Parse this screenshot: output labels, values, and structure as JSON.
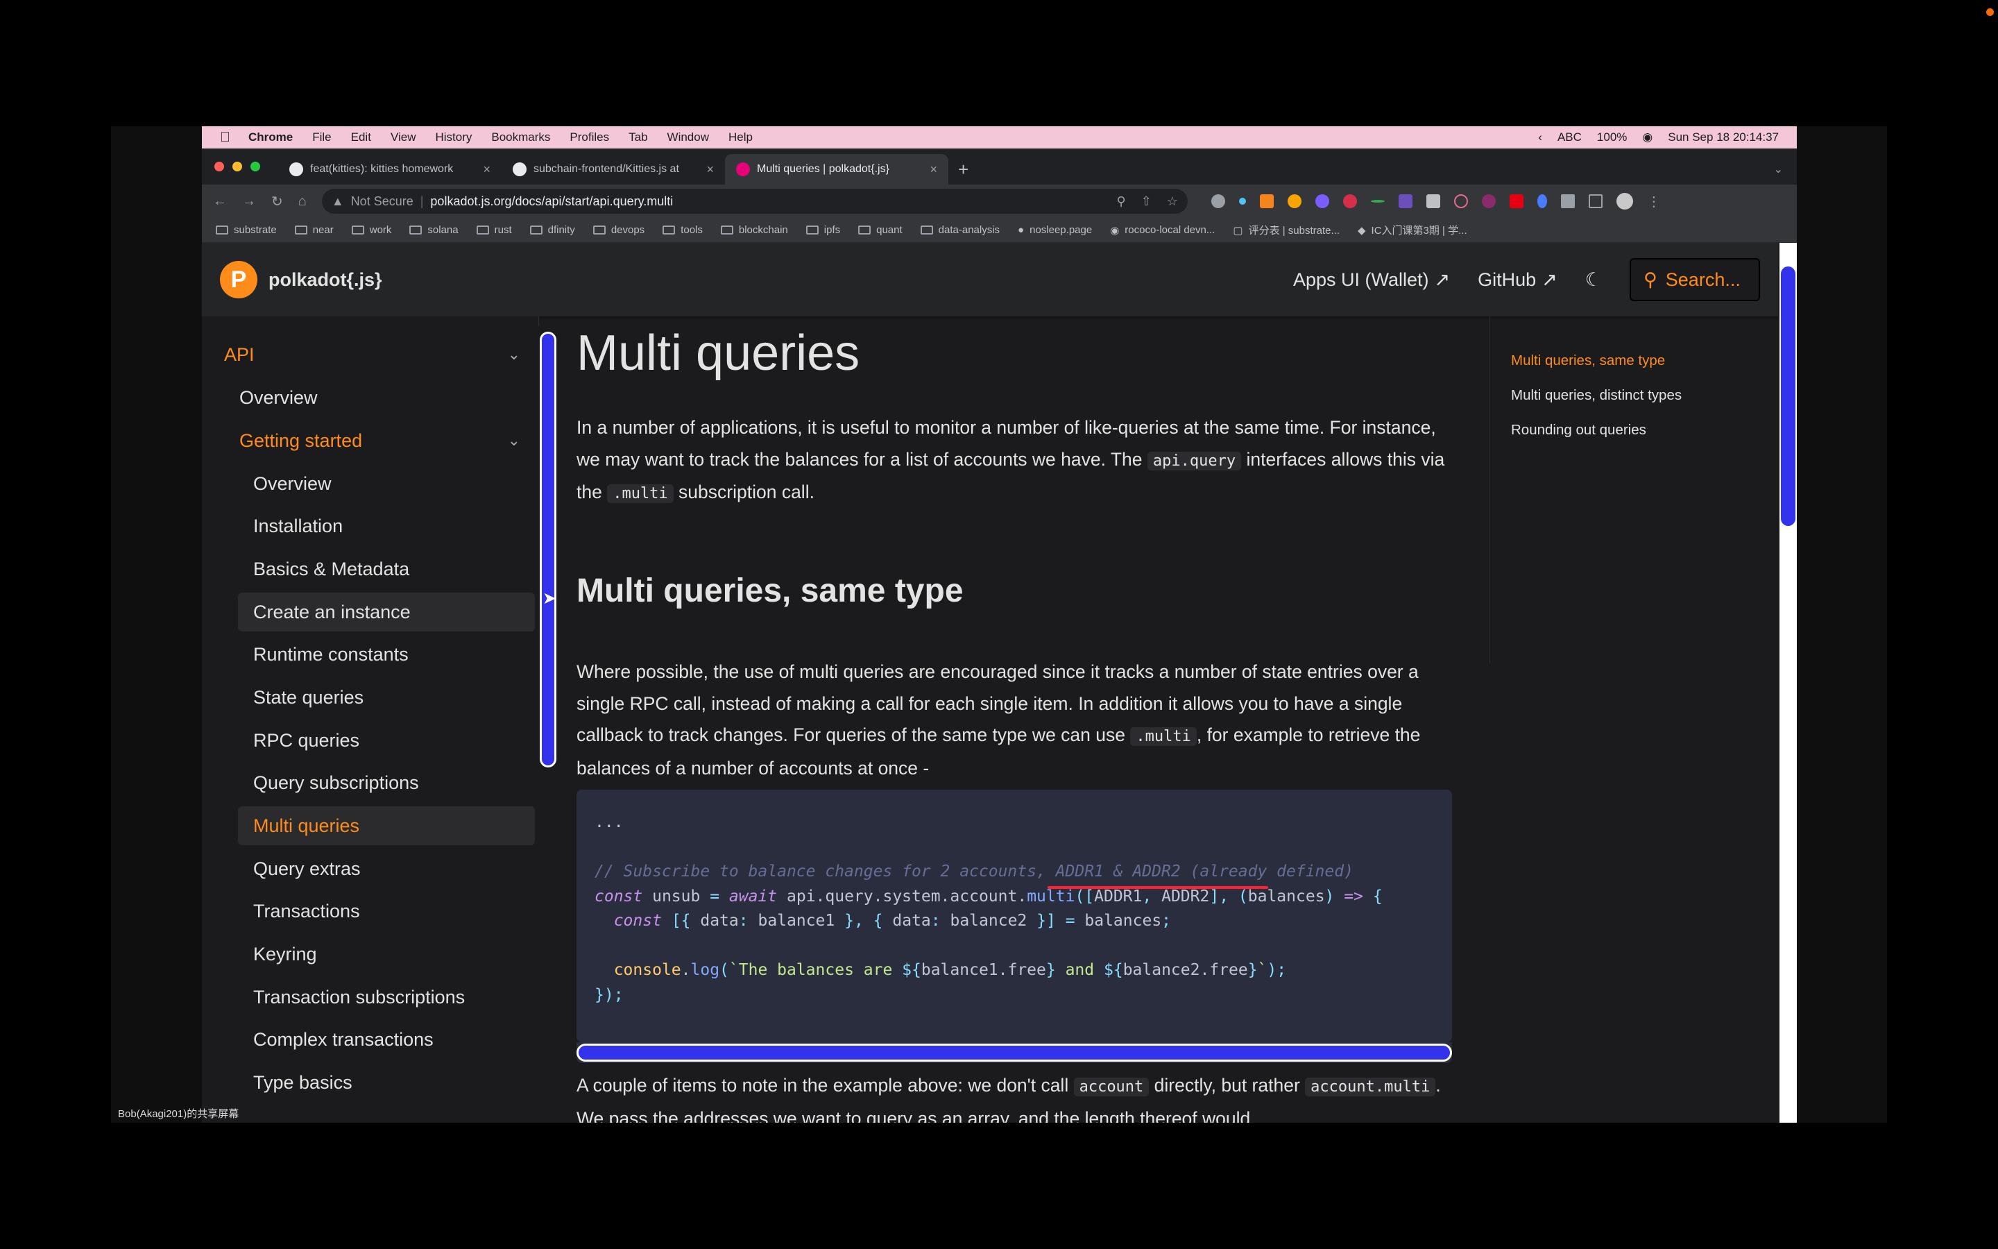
{
  "menubar": {
    "app": "Chrome",
    "items": [
      "File",
      "Edit",
      "View",
      "History",
      "Bookmarks",
      "Profiles",
      "Tab",
      "Window",
      "Help"
    ],
    "input_label": "ABC",
    "battery": "100%",
    "clock": "Sun Sep 18  20:14:37"
  },
  "tabs": [
    {
      "title": "feat(kitties): kitties homework"
    },
    {
      "title": "subchain-frontend/Kitties.js at"
    },
    {
      "title": "Multi queries | polkadot{.js}"
    }
  ],
  "toolbar": {
    "security": "Not Secure",
    "url": "polkadot.js.org/docs/api/start/api.query.multi"
  },
  "bookmarks": [
    "substrate",
    "near",
    "work",
    "solana",
    "rust",
    "dfinity",
    "devops",
    "tools",
    "blockchain",
    "ipfs",
    "quant",
    "data-analysis",
    "nosleep.page",
    "rococo-local devn...",
    "评分表 | substrate...",
    "IC入门课第3期 | 学..."
  ],
  "site": {
    "brand": "polkadot{.js}",
    "apps_ui": "Apps UI (Wallet)",
    "github": "GitHub",
    "search": "Search..."
  },
  "sidebar": {
    "section": "API",
    "items": [
      {
        "label": "Overview"
      },
      {
        "label": "Getting started"
      },
      {
        "label": "Overview"
      },
      {
        "label": "Installation"
      },
      {
        "label": "Basics & Metadata"
      },
      {
        "label": "Create an instance"
      },
      {
        "label": "Runtime constants"
      },
      {
        "label": "State queries"
      },
      {
        "label": "RPC queries"
      },
      {
        "label": "Query subscriptions"
      },
      {
        "label": "Multi queries"
      },
      {
        "label": "Query extras"
      },
      {
        "label": "Transactions"
      },
      {
        "label": "Keyring"
      },
      {
        "label": "Transaction subscriptions"
      },
      {
        "label": "Complex transactions"
      },
      {
        "label": "Type basics"
      }
    ]
  },
  "content": {
    "title": "Multi queries",
    "intro_1": "In a number of applications, it is useful to monitor a number of like-queries at the same time. For instance, we may want to track the balances for a list of accounts we have. The ",
    "intro_code_1": "api.query",
    "intro_2": " interfaces allows this via the ",
    "intro_code_2": ".multi",
    "intro_3": " subscription call.",
    "h2": "Multi queries, same type",
    "p2_1": "Where possible, the use of multi queries are encouraged since it tracks a number of state entries over a single RPC call, instead of making a call for each single item. In addition it allows you to have a single callback to track changes. For queries of the same type we can use ",
    "p2_code": ".multi",
    "p2_2": ", for example to retrieve the balances of a number of accounts at once -",
    "code_dots": "...",
    "code_comment": "// Subscribe to balance changes for 2 accounts, ADDR1 & ADDR2 (already defined)",
    "p3_1": "A couple of items to note in the example above: we don't call ",
    "p3_code_1": "account",
    "p3_2": " directly, but rather ",
    "p3_code_2": "account.multi",
    "p3_3": ". We pass the addresses we want to query as an array, and the length thereof would"
  },
  "toc": [
    "Multi queries, same type",
    "Multi queries, distinct types",
    "Rounding out queries"
  ],
  "share_label": "Bob(Akagi201)的共享屏幕"
}
